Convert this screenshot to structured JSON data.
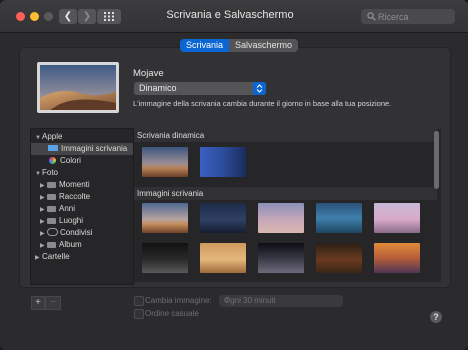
{
  "window": {
    "title": "Scrivania e Salvaschermo"
  },
  "search": {
    "placeholder": "Ricerca"
  },
  "tabs": [
    {
      "label": "Scrivania"
    },
    {
      "label": "Salvaschermo"
    }
  ],
  "current": {
    "name": "Mojave",
    "mode": "Dinamico",
    "description": "L'immagine della scrivania cambia durante il giorno in base alla tua posizione."
  },
  "sidebar": {
    "apple": {
      "label": "Apple",
      "items": [
        {
          "label": "Immagini scrivania"
        },
        {
          "label": "Colori"
        }
      ]
    },
    "foto": {
      "label": "Foto",
      "items": [
        {
          "label": "Momenti"
        },
        {
          "label": "Raccolte"
        },
        {
          "label": "Anni"
        },
        {
          "label": "Luoghi"
        },
        {
          "label": "Condivisi"
        },
        {
          "label": "Album"
        }
      ]
    },
    "cartelle": {
      "label": "Cartelle"
    }
  },
  "gallery": {
    "dynamic_header": "Scrivania dinamica",
    "images_header": "Immagini scrivania"
  },
  "bottom": {
    "add": "+",
    "remove": "−",
    "change_label": "Cambia immagine:",
    "interval": "Ogni 30 minuti",
    "random_label": "Ordine casuale",
    "help": "?"
  },
  "colors": {
    "accent": "#0b66d4"
  }
}
